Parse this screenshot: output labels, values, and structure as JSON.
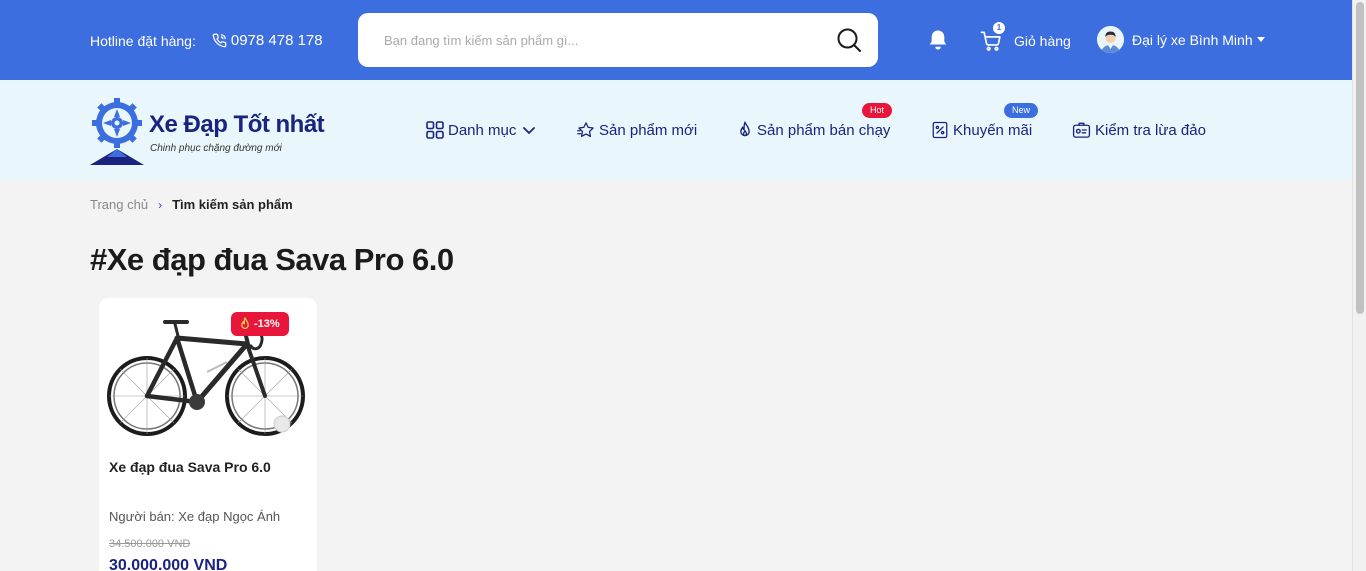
{
  "header": {
    "hotline_label": "Hotline đặt hàng:",
    "hotline_number": "0978 478 178",
    "search_placeholder": "Bạn đang tìm kiếm sản phẩm gì...",
    "cart_label": "Giỏ hàng",
    "cart_count": "1",
    "user_name": "Đại lý xe Bình Minh"
  },
  "brand": {
    "name": "Xe Đạp Tốt nhất",
    "slogan": "Chinh phục chặng đường mới"
  },
  "nav": {
    "items": [
      {
        "label": "Danh mục",
        "icon": "grid-icon"
      },
      {
        "label": "Sản phẩm mới",
        "icon": "star-icon"
      },
      {
        "label": "Sản phẩm bán chạy",
        "icon": "flame-icon",
        "badge": "Hot"
      },
      {
        "label": "Khuyến mãi",
        "icon": "discount-icon",
        "badge": "New"
      },
      {
        "label": "Kiểm tra lừa đảo",
        "icon": "id-card-icon"
      }
    ]
  },
  "breadcrumb": {
    "home": "Trang chủ",
    "separator": "›",
    "current": "Tìm kiếm sản phẩm"
  },
  "page": {
    "title": "#Xe đạp đua Sava Pro 6.0"
  },
  "products": [
    {
      "name": "Xe đạp đua Sava Pro 6.0",
      "discount": "-13%",
      "seller": "Người bán: Xe đạp Ngọc Ánh",
      "old_price": "34.500.000 VND",
      "new_price": "30.000.000 VND"
    }
  ],
  "colors": {
    "primary": "#3c6ee0",
    "nav_bg": "#e9f7fc",
    "navy": "#1a237e",
    "hot": "#e8163a"
  }
}
